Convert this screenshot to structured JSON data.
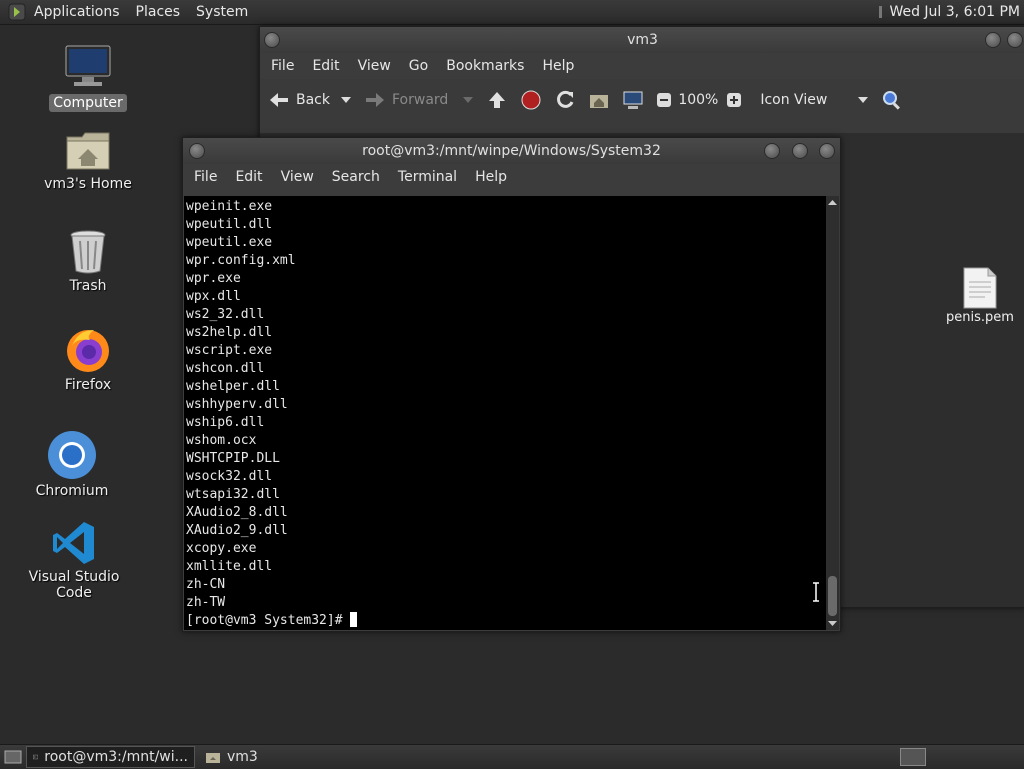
{
  "top_panel": {
    "menus": [
      "Applications",
      "Places",
      "System"
    ],
    "clock": "Wed Jul  3,  6:01 PM"
  },
  "desktop": {
    "icons": [
      {
        "label": "Computer",
        "icon": "computer-icon"
      },
      {
        "label": "vm3's Home",
        "icon": "home-folder-icon"
      },
      {
        "label": "Trash",
        "icon": "trash-icon"
      },
      {
        "label": "Firefox",
        "icon": "firefox-icon"
      },
      {
        "label": "Chromium",
        "icon": "chromium-icon"
      },
      {
        "label": "Visual Studio Code",
        "icon": "vscode-icon"
      }
    ]
  },
  "file_manager": {
    "title": "vm3",
    "menus": [
      "File",
      "Edit",
      "View",
      "Go",
      "Bookmarks",
      "Help"
    ],
    "toolbar": {
      "back": "Back",
      "forward": "Forward",
      "zoom": "100%",
      "view_mode": "Icon View"
    },
    "files": [
      {
        "name": "penis.pem",
        "icon": "text-file-icon"
      }
    ]
  },
  "terminal": {
    "title": "root@vm3:/mnt/winpe/Windows/System32",
    "menus": [
      "File",
      "Edit",
      "View",
      "Search",
      "Terminal",
      "Help"
    ],
    "lines": [
      "wpeinit.exe",
      "wpeutil.dll",
      "wpeutil.exe",
      "wpr.config.xml",
      "wpr.exe",
      "wpx.dll",
      "ws2_32.dll",
      "ws2help.dll",
      "wscript.exe",
      "wshcon.dll",
      "wshelper.dll",
      "wshhyperv.dll",
      "wship6.dll",
      "wshom.ocx",
      "WSHTCPIP.DLL",
      "wsock32.dll",
      "wtsapi32.dll",
      "XAudio2_8.dll",
      "XAudio2_9.dll",
      "xcopy.exe",
      "xmllite.dll",
      "zh-CN",
      "zh-TW"
    ],
    "prompt": "[root@vm3 System32]# "
  },
  "taskbar": {
    "tasks": [
      {
        "label": "root@vm3:/mnt/wi...",
        "active": true
      },
      {
        "label": "vm3",
        "active": false
      }
    ]
  }
}
